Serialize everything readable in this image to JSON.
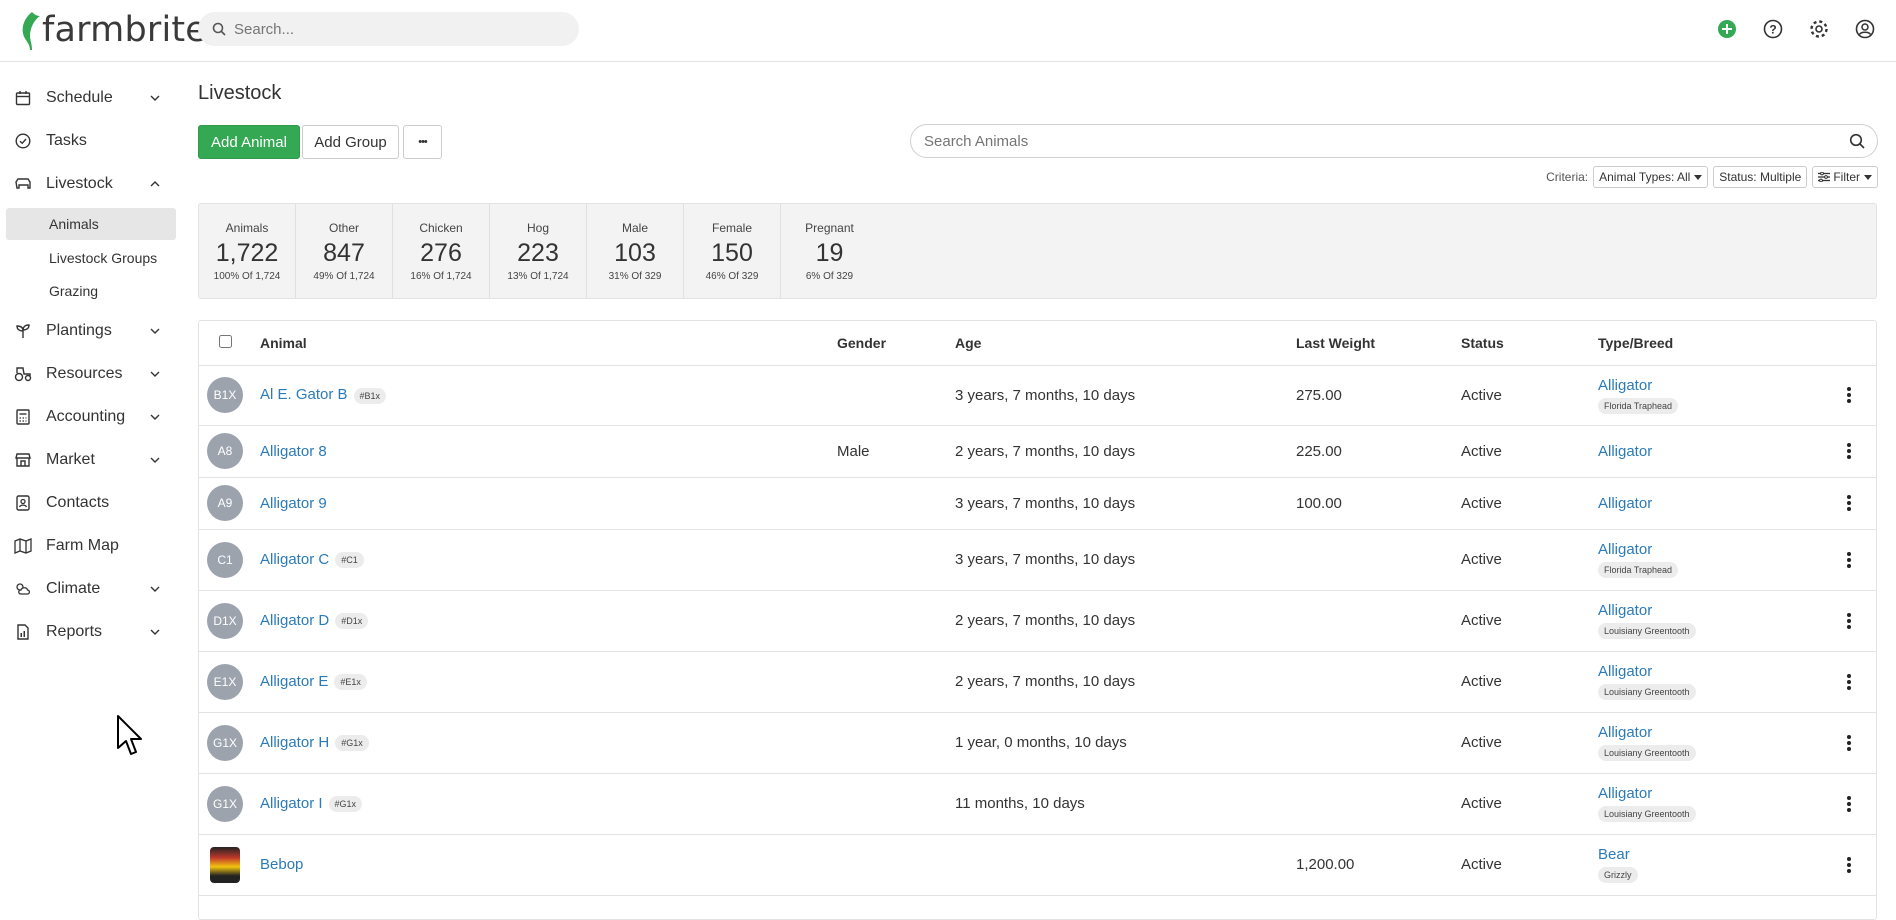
{
  "app": {
    "logo_text": "farmbrite",
    "search_placeholder": "Search..."
  },
  "sidebar": {
    "items": [
      {
        "label": "Schedule",
        "icon": "calendar-icon",
        "expandable": true
      },
      {
        "label": "Tasks",
        "icon": "check-circle-icon",
        "expandable": false
      },
      {
        "label": "Livestock",
        "icon": "cow-icon",
        "expandable": true,
        "expanded": true
      },
      {
        "label": "Plantings",
        "icon": "sprout-icon",
        "expandable": true
      },
      {
        "label": "Resources",
        "icon": "tractor-icon",
        "expandable": true
      },
      {
        "label": "Accounting",
        "icon": "calculator-icon",
        "expandable": true
      },
      {
        "label": "Market",
        "icon": "store-icon",
        "expandable": true
      },
      {
        "label": "Contacts",
        "icon": "contacts-icon",
        "expandable": false
      },
      {
        "label": "Farm Map",
        "icon": "map-icon",
        "expandable": false
      },
      {
        "label": "Climate",
        "icon": "cloud-sun-icon",
        "expandable": true
      },
      {
        "label": "Reports",
        "icon": "report-icon",
        "expandable": true
      }
    ],
    "livestock_sub": [
      "Animals",
      "Livestock Groups",
      "Grazing"
    ]
  },
  "main": {
    "title": "Livestock",
    "add_animal": "Add Animal",
    "add_group": "Add Group",
    "more": "•••",
    "search_animals_placeholder": "Search Animals",
    "criteria_label": "Criteria:",
    "criteria_types": "Animal Types: All",
    "criteria_status": "Status: Multiple",
    "criteria_filter": "Filter"
  },
  "stats": [
    {
      "name": "Animals",
      "value": "1,722",
      "sub": "100% Of 1,724"
    },
    {
      "name": "Other",
      "value": "847",
      "sub": "49% Of 1,724"
    },
    {
      "name": "Chicken",
      "value": "276",
      "sub": "16% Of 1,724"
    },
    {
      "name": "Hog",
      "value": "223",
      "sub": "13% Of 1,724"
    },
    {
      "name": "Male",
      "value": "103",
      "sub": "31% Of 329"
    },
    {
      "name": "Female",
      "value": "150",
      "sub": "46% Of 329"
    },
    {
      "name": "Pregnant",
      "value": "19",
      "sub": "6% Of 329"
    }
  ],
  "table": {
    "headers": {
      "animal": "Animal",
      "gender": "Gender",
      "age": "Age",
      "weight": "Last Weight",
      "status": "Status",
      "type": "Type/Breed"
    },
    "rows": [
      {
        "initials": "B1X",
        "name": "Al E. Gator B",
        "tag": "#B1x",
        "gender": "",
        "age": "3 years, 7 months, 10 days",
        "weight": "275.00",
        "status": "Active",
        "type": "Alligator",
        "breed": "Florida Traphead"
      },
      {
        "initials": "A8",
        "name": "Alligator 8",
        "tag": "",
        "gender": "Male",
        "age": "2 years, 7 months, 10 days",
        "weight": "225.00",
        "status": "Active",
        "type": "Alligator",
        "breed": ""
      },
      {
        "initials": "A9",
        "name": "Alligator 9",
        "tag": "",
        "gender": "",
        "age": "3 years, 7 months, 10 days",
        "weight": "100.00",
        "status": "Active",
        "type": "Alligator",
        "breed": ""
      },
      {
        "initials": "C1",
        "name": "Alligator C",
        "tag": "#C1",
        "gender": "",
        "age": "3 years, 7 months, 10 days",
        "weight": "",
        "status": "Active",
        "type": "Alligator",
        "breed": "Florida Traphead"
      },
      {
        "initials": "D1X",
        "name": "Alligator D",
        "tag": "#D1x",
        "gender": "",
        "age": "2 years, 7 months, 10 days",
        "weight": "",
        "status": "Active",
        "type": "Alligator",
        "breed": "Louisiany Greentooth"
      },
      {
        "initials": "E1X",
        "name": "Alligator E",
        "tag": "#E1x",
        "gender": "",
        "age": "2 years, 7 months, 10 days",
        "weight": "",
        "status": "Active",
        "type": "Alligator",
        "breed": "Louisiany Greentooth"
      },
      {
        "initials": "G1X",
        "name": "Alligator H",
        "tag": "#G1x",
        "gender": "",
        "age": "1 year, 0 months, 10 days",
        "weight": "",
        "status": "Active",
        "type": "Alligator",
        "breed": "Louisiany Greentooth"
      },
      {
        "initials": "G1X",
        "name": "Alligator I",
        "tag": "#G1x",
        "gender": "",
        "age": "11 months, 10 days",
        "weight": "",
        "status": "Active",
        "type": "Alligator",
        "breed": "Louisiany Greentooth"
      },
      {
        "initials": "",
        "name": "Bebop",
        "tag": "",
        "gender": "",
        "age": "",
        "weight": "1,200.00",
        "status": "Active",
        "type": "Bear",
        "breed": "Grizzly",
        "photo": true
      }
    ]
  },
  "colors": {
    "brand_green": "#34a853",
    "link_blue": "#2b7bb9",
    "avatar_gray": "#9da3ad"
  }
}
